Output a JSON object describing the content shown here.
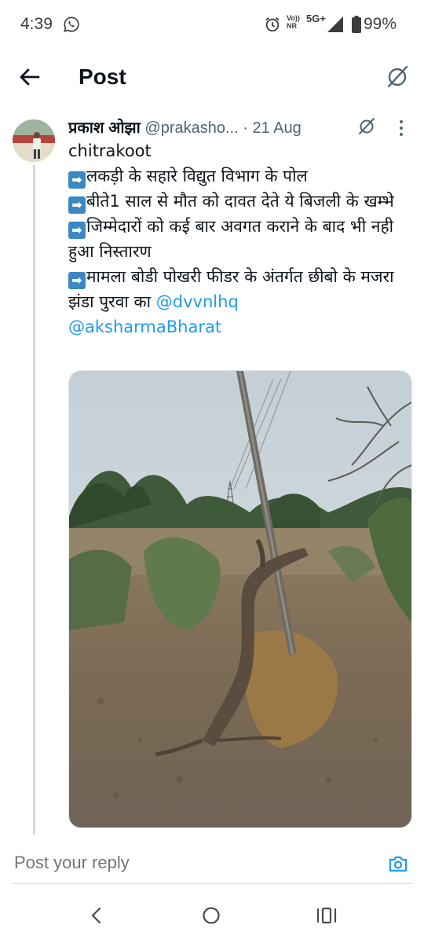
{
  "status_bar": {
    "time": "4:39",
    "volte_line1": "Vo))",
    "volte_line2": "NR",
    "network": "5G+",
    "battery": "99%"
  },
  "header": {
    "title": "Post",
    "back_icon": "arrow-left-icon",
    "grok_icon": "grok-icon"
  },
  "tweet": {
    "author_name": "प्रकाश ओझा",
    "handle": "@prakasho...",
    "separator": "·",
    "date": "21 Aug",
    "lines": {
      "location": "chitrakoot",
      "l1": "लकड़ी के सहारे विद्युत विभाग के पोल",
      "l2": "बीते1 साल से मौत को दावत देते ये बिजली के खम्भे",
      "l3": "जिम्मेदारों को कई बार अवगत कराने के बाद भी नही हुआ निस्तारण",
      "l4": "मामला बोडी पोखरी फीडर के अंतर्गत छीबो के मजरा झंडा पुरवा का"
    },
    "mention1": "@dvvnlhq",
    "mention2": "@aksharmaBharat",
    "arrow_emoji": "➡"
  },
  "reply": {
    "placeholder": "Post your reply",
    "camera_icon": "camera-icon"
  },
  "colors": {
    "link": "#1d9bf0",
    "secondary_text": "#536471",
    "primary_text": "#0f1419"
  }
}
